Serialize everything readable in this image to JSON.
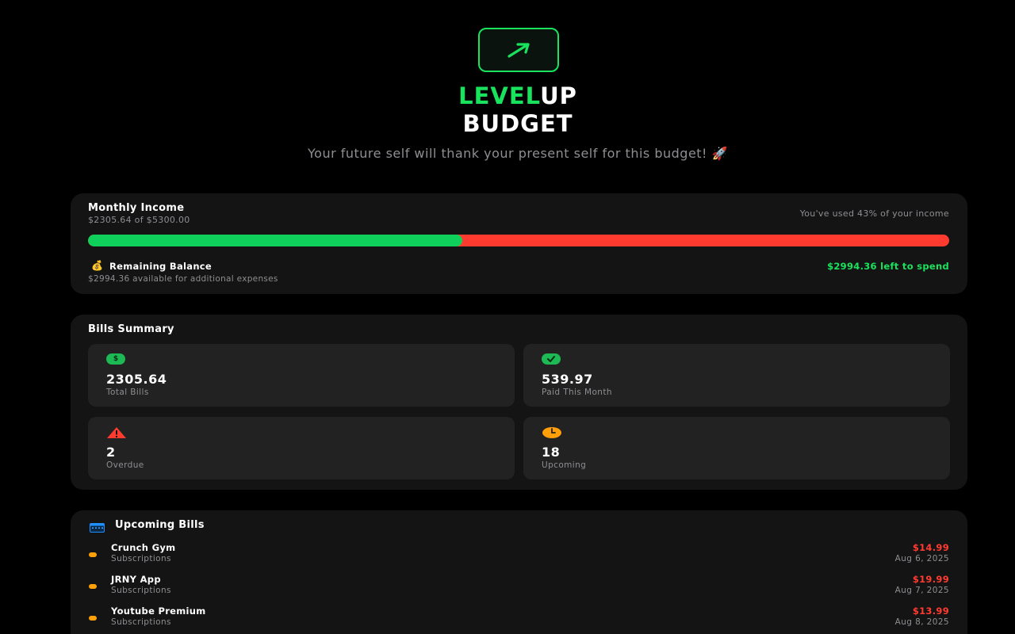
{
  "header": {
    "brand_accent": "LEVEL",
    "brand_rest": "UP",
    "brand_line2": "BUDGET",
    "tagline": "Your future self will thank your present self for this budget! 🚀",
    "logo_icon": "arrow-up-right-icon"
  },
  "income": {
    "title": "Monthly Income",
    "subtitle": "$2305.64 of $5300.00",
    "used_text": "You've used 43% of your income",
    "used_fraction": 0.435,
    "remaining_icon": "💰",
    "remaining_label": "Remaining Balance",
    "remaining_sub": "$2994.36 available for additional expenses",
    "left_to_spend": "$2994.36 left to spend"
  },
  "bills_summary": {
    "title": "Bills Summary",
    "stats": [
      {
        "value": "2305.64",
        "label": "Total Bills",
        "icon": "dollar-icon",
        "color": "#1db954"
      },
      {
        "value": "539.97",
        "label": "Paid This Month",
        "icon": "checkmark-icon",
        "color": "#1db954"
      },
      {
        "value": "2",
        "label": "Overdue",
        "icon": "warning-icon",
        "color": "#ff3b30"
      },
      {
        "value": "18",
        "label": "Upcoming",
        "icon": "clock-icon",
        "color": "#ff9f0a"
      }
    ]
  },
  "upcoming": {
    "title": "Upcoming Bills",
    "icon": "calendar-icon",
    "bills": [
      {
        "name": "Crunch Gym",
        "category": "Subscriptions",
        "amount": "$14.99",
        "date": "Aug 6, 2025"
      },
      {
        "name": "JRNY App",
        "category": "Subscriptions",
        "amount": "$19.99",
        "date": "Aug 7, 2025"
      },
      {
        "name": "Youtube Premium",
        "category": "Subscriptions",
        "amount": "$13.99",
        "date": "Aug 8, 2025"
      }
    ]
  },
  "colors": {
    "accent_green": "#19e35c",
    "danger_red": "#ff3b30",
    "warning_orange": "#ff9f0a",
    "background": "#000000",
    "card": "#141414"
  }
}
